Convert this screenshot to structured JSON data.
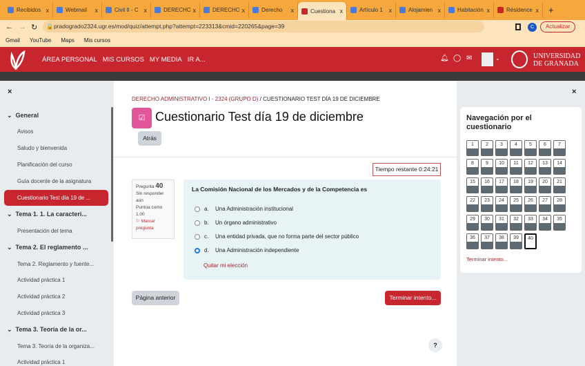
{
  "browser": {
    "tabs": [
      "Recibidos",
      "Webmail",
      "Civil II - C",
      "DERECHO",
      "DERECHO",
      "Derecho",
      "Cuestiona",
      "Artículo 1",
      "Alojamien",
      "Habitación",
      "Résidence"
    ],
    "active_tab": 6,
    "url": "pradogrado2324.ugr.es/mod/quiz/attempt.php?attempt=223313&cmid=220265&page=39",
    "update_label": "Actualizar",
    "profile_initial": "C",
    "bookmarks": [
      "Gmail",
      "YouTube",
      "Maps",
      "Mis cursos"
    ]
  },
  "navbar": {
    "links": [
      "ÁREA PERSONAL",
      "MIS CURSOS",
      "MY MEDIA",
      "IR A..."
    ],
    "university": [
      "UNIVERSIDAD",
      "DE GRANADA"
    ]
  },
  "sidebar": {
    "close": "×",
    "items": [
      {
        "type": "sec",
        "label": "General"
      },
      {
        "type": "item",
        "label": "Avisos"
      },
      {
        "type": "item",
        "label": "Saludo y bienvenida"
      },
      {
        "type": "item",
        "label": "Planificación del curso"
      },
      {
        "type": "item",
        "label": "Guía docente de la asignatura"
      },
      {
        "type": "sel",
        "label": "Cuestionario Test día 19 de ..."
      },
      {
        "type": "sec",
        "label": "Tema 1. 1. La caracteri..."
      },
      {
        "type": "item",
        "label": "Presentación del tema"
      },
      {
        "type": "sec",
        "label": "Tema 2. El reglamento ..."
      },
      {
        "type": "item",
        "label": "Tema 2. Reglamento y fuente..."
      },
      {
        "type": "item",
        "label": "Actividad práctica 1"
      },
      {
        "type": "item",
        "label": "Actividad práctica 2"
      },
      {
        "type": "item",
        "label": "Actividad práctica 3"
      },
      {
        "type": "sec",
        "label": "Tema 3. Teoría de la or..."
      },
      {
        "type": "item",
        "label": "Tema 3. Teoría de la organiza..."
      },
      {
        "type": "item",
        "label": "Actividad práctica 1"
      }
    ]
  },
  "main": {
    "breadcrumb_course": "DERECHO ADMINISTRATIVO I - 2324 (GRUPO D)",
    "breadcrumb_sep": "/",
    "breadcrumb_page": "CUESTIONARIO TEST DÍA 19 DE DICIEMBRE",
    "title": "Cuestionario Test día 19 de diciembre",
    "back": "Atrás",
    "timer": "Tiempo restante 0:24:21",
    "info": {
      "label": "Pregunta",
      "number": "40",
      "status": "Sin responder aún",
      "score": "Puntúa como 1,00",
      "flag": "Marcar pregunta"
    },
    "question": "La Comisión Nacional de los Mercados y de la Competencia es",
    "options": [
      {
        "letter": "a.",
        "text": "Una Administración institucional"
      },
      {
        "letter": "b.",
        "text": "Un órgano administrativo"
      },
      {
        "letter": "c.",
        "text": "Una entidad privada, que no forma parte del sector público"
      },
      {
        "letter": "d.",
        "text": "Una Administración independiente"
      }
    ],
    "selected": 3,
    "clear": "Quitar mi elección",
    "prev": "Página anterior",
    "finish": "Terminar intento...",
    "help": "?"
  },
  "quiznav": {
    "title": "Navegación por el cuestionario",
    "count": 40,
    "current": 40,
    "finish": "Terminar intento..."
  }
}
